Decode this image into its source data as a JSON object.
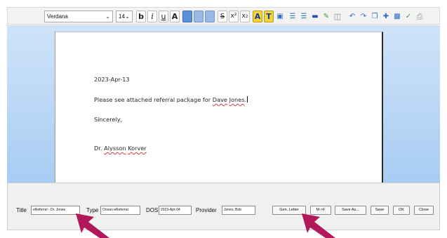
{
  "toolbar": {
    "font_family": "Verdana",
    "font_size": "14",
    "buttons": [
      "b",
      "i",
      "u",
      "A",
      "S",
      "x²",
      "x₂",
      "A",
      "T"
    ]
  },
  "letter": {
    "date": "2023-Apr-13",
    "body_start": "Please see attached referral package for ",
    "patient_first": "Dave",
    "patient_last": "Jones",
    "period": ".",
    "closing": "Sincerely,",
    "sig_prefix": "Dr. ",
    "sig_first": "Alysson",
    "sig_last": "Korver"
  },
  "form": {
    "title_label": "Title",
    "title_value": "eReferral - Dr. Jones",
    "type_label": "Type",
    "type_value": "Ocean eReferral",
    "dos_label": "DOS",
    "dos_value": "2023-Apr-04",
    "provider_label": "Provider",
    "provider_value": "Jones, Bob"
  },
  "buttons": {
    "gen_letter": "Gen. Letter",
    "m_to_f": "M->F",
    "save_as": "Save As...",
    "save": "Save",
    "ok": "OK",
    "close": "Close"
  },
  "colors": {
    "arrow": "#b1185a",
    "editor_bg": "#bcd8f6"
  }
}
